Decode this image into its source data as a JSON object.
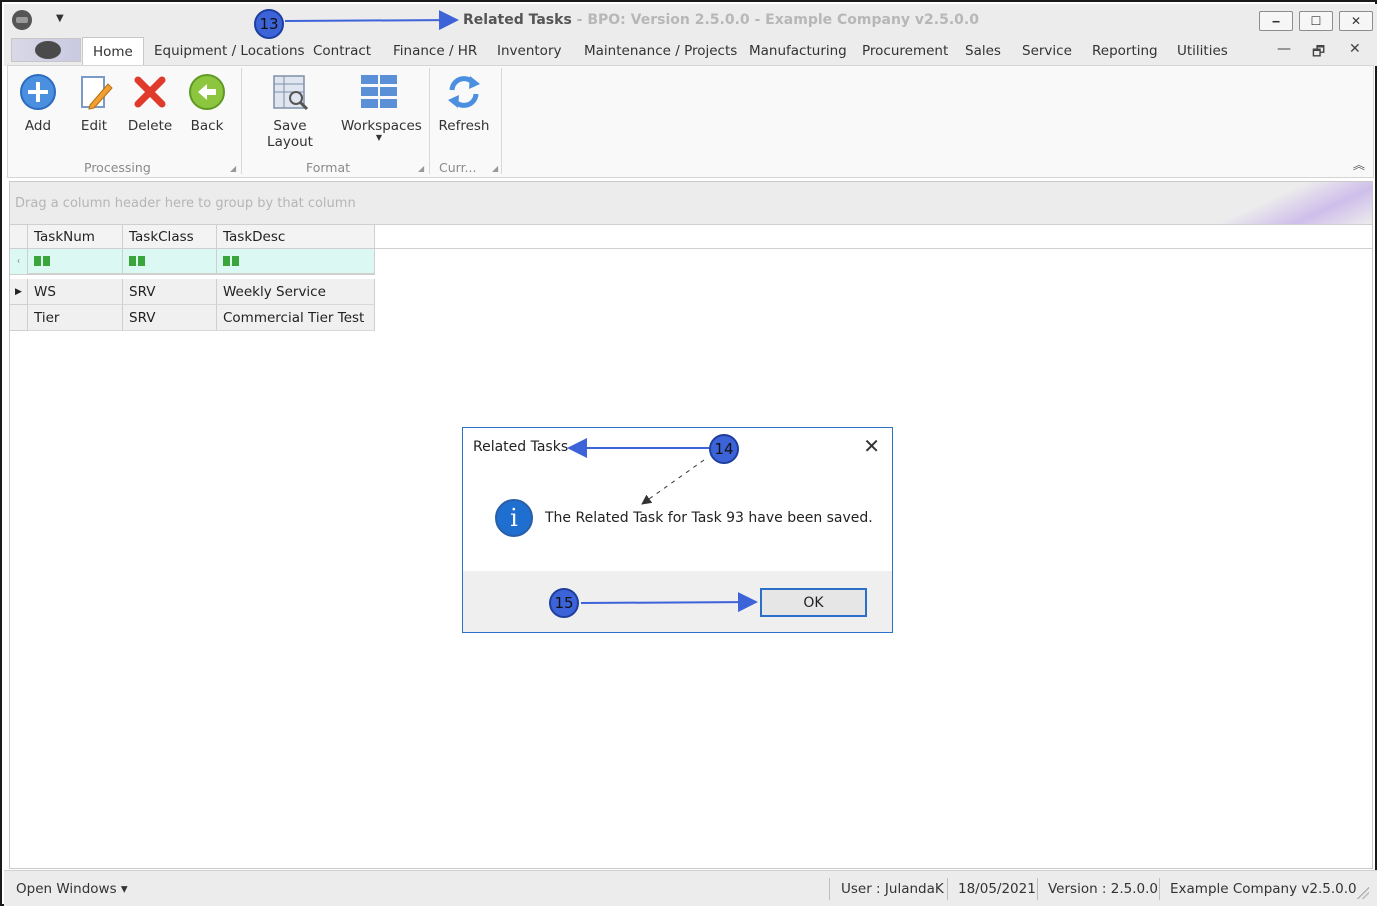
{
  "window": {
    "title_main": "Related Tasks",
    "title_sub": " - BPO: Version 2.5.0.0 - Example Company v2.5.0.0",
    "qat_arrow": "▼",
    "minimize": "‒",
    "maximize": "☐",
    "close": "✕"
  },
  "tabs": [
    {
      "label": "Home",
      "active": true
    },
    {
      "label": "Equipment / Locations"
    },
    {
      "label": "Contract"
    },
    {
      "label": "Finance / HR"
    },
    {
      "label": "Inventory"
    },
    {
      "label": "Maintenance / Projects"
    },
    {
      "label": "Manufacturing"
    },
    {
      "label": "Procurement"
    },
    {
      "label": "Sales"
    },
    {
      "label": "Service"
    },
    {
      "label": "Reporting"
    },
    {
      "label": "Utilities"
    }
  ],
  "mdi": {
    "minimize": "—",
    "restore": "🗗",
    "close": "✕"
  },
  "ribbon": {
    "groups": [
      {
        "label": "Processing",
        "buttons": [
          "Add",
          "Edit",
          "Delete",
          "Back"
        ]
      },
      {
        "label": "Format",
        "buttons": [
          "Save Layout",
          "Workspaces"
        ]
      },
      {
        "label": "Curr...",
        "buttons": [
          "Refresh"
        ]
      }
    ],
    "corner": "◢",
    "collapse": "︽"
  },
  "grid": {
    "group_hint": "Drag a column header here to group by that column",
    "columns": [
      "TaskNum",
      "TaskClass",
      "TaskDesc"
    ],
    "filter_glyph": "ABC",
    "rows": [
      [
        "WS",
        "SRV",
        "Weekly Service"
      ],
      [
        "Tier",
        "SRV",
        "Commercial Tier Test"
      ]
    ],
    "filter_indicator": "ᚲ",
    "current_row_indicator": "▶"
  },
  "statusbar": {
    "open_windows": "Open Windows ▾",
    "user": "User : JulandaK",
    "date": "18/05/2021",
    "version": "Version : 2.5.0.0",
    "company": "Example Company v2.5.0.0"
  },
  "dialog": {
    "title": "Related Tasks",
    "close": "✕",
    "info_glyph": "i",
    "message": "The Related Task for Task 93 have been saved.",
    "ok_label": "OK"
  },
  "annotations": {
    "badge_13": "13",
    "badge_14": "14",
    "badge_15": "15"
  },
  "colors": {
    "annotation": "#3d63d8",
    "accent": "#2a73c8",
    "filter_row": "#dcf8f3"
  }
}
